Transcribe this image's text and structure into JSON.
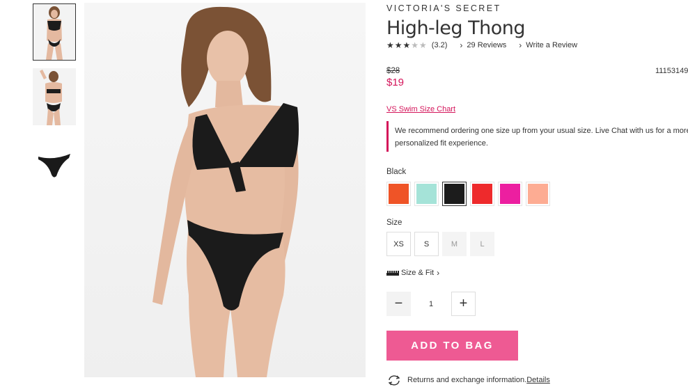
{
  "brand": "VICTORIA'S SECRET",
  "product": {
    "title": "High-leg Thong",
    "rating_value": "(3.2)",
    "rating_stars": 3,
    "reviews_label": "29 Reviews",
    "write_review_label": "Write a Review",
    "price_original": "$28",
    "price_sale": "$19",
    "sku": "11153149"
  },
  "size_chart_label": "VS Swim Size Chart",
  "fit_note": "We recommend ordering one size up from your usual size. Live Chat with us for a more personalized fit experience.",
  "color": {
    "selected_label": "Black",
    "swatches": [
      "#ef5427",
      "#a5e3d8",
      "#1c1c1c",
      "#ee2a2c",
      "#ec1fa0",
      "#fdac93"
    ],
    "selected_index": 2
  },
  "size": {
    "label": "Size",
    "options": [
      "XS",
      "S",
      "M",
      "L"
    ],
    "unavailable": [
      "M",
      "L"
    ]
  },
  "size_fit_label": "Size & Fit",
  "quantity": {
    "value": "1"
  },
  "add_to_bag_label": "ADD TO BAG",
  "returns": {
    "text": "Returns and exchange information.",
    "details_label": "Details"
  },
  "colors": {
    "accent": "#d4145a",
    "button": "#ee5a93"
  }
}
